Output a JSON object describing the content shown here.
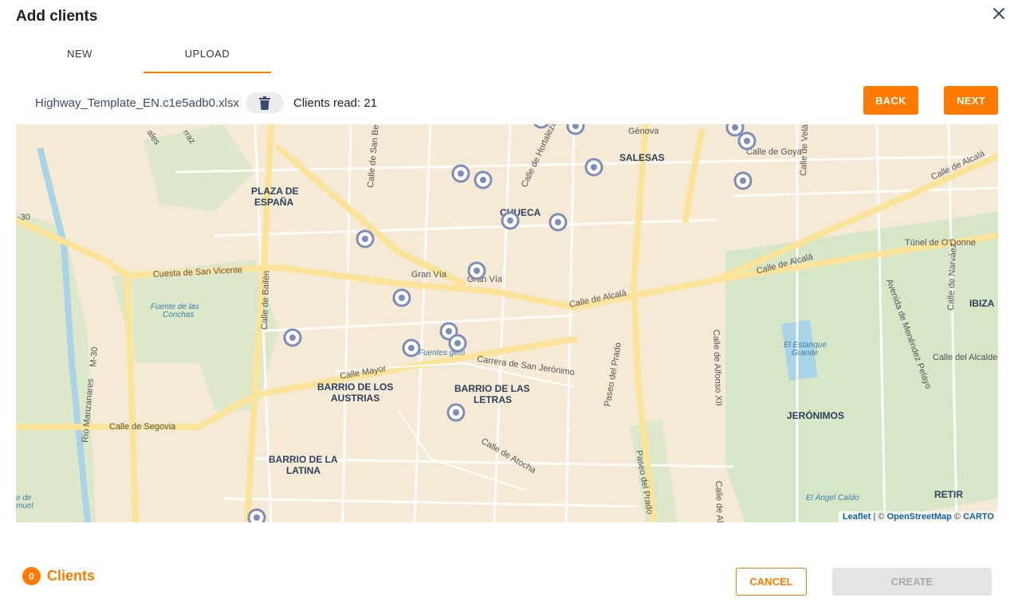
{
  "dialog": {
    "title": "Add clients"
  },
  "tabs": [
    {
      "label": "NEW",
      "active": false
    },
    {
      "label": "UPLOAD",
      "active": true
    }
  ],
  "upload": {
    "file_name": "Highway_Template_EN.c1e5adb0.xlsx",
    "clients_read": "Clients read: 21"
  },
  "actions": {
    "back": "BACK",
    "next": "NEXT",
    "cancel": "CANCEL",
    "create": "CREATE"
  },
  "map": {
    "labels": {
      "plaza_espana": [
        "PLAZA DE",
        "ESPAÑA"
      ],
      "salesas": "SALESAS",
      "chueca": "CHUECA",
      "barrio_austrias": [
        "BARRIO DE LOS",
        "AUSTRIAS"
      ],
      "barrio_letras": [
        "BARRIO DE LAS",
        "LETRAS"
      ],
      "barrio_latina": [
        "BARRIO DE LA",
        "LATINA"
      ],
      "jeronimos": "JERÓNIMOS",
      "ibiza": "IBIZA",
      "retiro": "RETIR",
      "cuesta_san_vicente": "Cuesta de San Vicente",
      "gran_via_1": "Gran Vía",
      "gran_via_2": "Gran Vía",
      "calle_alcala_1": "Calle de Alcalá",
      "calle_alcala_2": "Calle de Alcalá",
      "calle_alcala_3": "Calle de Alcalá",
      "calle_del_alcalde": "Calle del Alcalde",
      "tunel_odonnell": "Túnel de O'Donne",
      "calle_goya": "Calle de Goya",
      "calle_genova": "Génova",
      "calle_hortaleza": "Calle de Hortaleza",
      "calle_mayor": "Calle Mayor",
      "carrera_san_jeronimo": "Carrera de San Jerónimo",
      "calle_segovia": "Calle de Segovia",
      "calle_atocha": "Calle de Atocha",
      "calle_bailen": "Calle de Bailén",
      "paseo_prado_1": "Paseo del Prado",
      "paseo_prado_2": "Paseo del Prado",
      "calle_alfonso": "Calle de Alfonso XII",
      "avenida_menendez": "Avenida de Menéndez Pelayo",
      "estanque": [
        "El Estanque",
        "Grande"
      ],
      "fuente_conchas": [
        "Fuente de las",
        "Conchas"
      ],
      "fuentes_gem": "Fuentes gem",
      "angel_caido": "El Ángel Caído",
      "rio_manzanares": "Río Manzanares",
      "m30": "M-30",
      "m30_2": "-30",
      "calle_san_bernardo": "Calle de San Ber",
      "calle_velazquez": "Calle de Velázq",
      "calle_narvaez": "Calle de Narváez",
      "calle_alfonso_2": "Calle de Alfonso",
      "calle_ferraz": "rraz",
      "calle_princesa": "ales",
      "samuel": [
        "e de",
        "muel"
      ]
    },
    "zoom_in": "+",
    "zoom_out": "−",
    "attribution": {
      "leaflet": "Leaflet",
      "sep1": " | © ",
      "osm": "OpenStreetMap",
      "sep2": " © ",
      "carto": "CARTO"
    }
  },
  "footer": {
    "count": "0",
    "count_label": "Clients"
  },
  "colors": {
    "accent": "#ff7a00",
    "marker": "#7d8db8",
    "park": "#d8e6c8",
    "road": "#fbe39a"
  },
  "icons": {
    "close": "close-icon",
    "delete": "trash-icon",
    "marker": "map-marker-icon"
  }
}
